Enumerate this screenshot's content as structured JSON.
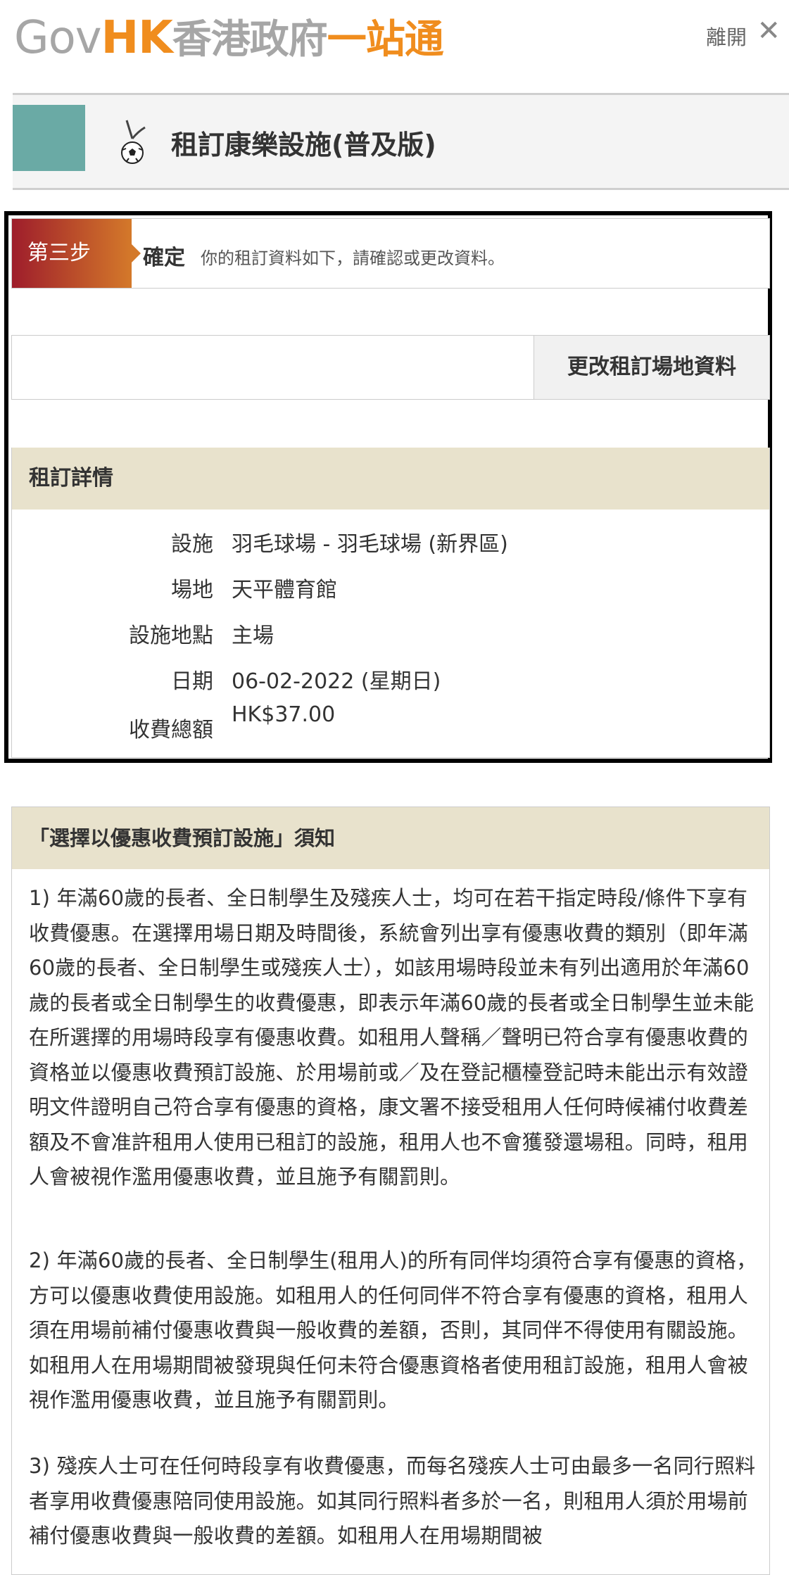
{
  "header": {
    "logo_gov": "Gov",
    "logo_hk": "HK",
    "logo_zh": "香港政府",
    "logo_zh2": "一站通",
    "leave_label": "離開",
    "close_label": "✕"
  },
  "page": {
    "title": "租訂康樂設施(普及版)"
  },
  "step": {
    "badge": "第三步",
    "name": "確定",
    "description": "你的租訂資料如下，請確認或更改資料。"
  },
  "change_button": "更改租訂場地資料",
  "details": {
    "heading": "租訂詳情",
    "rows": [
      {
        "label": "設施",
        "value": "羽毛球場 - 羽毛球場 (新界區)"
      },
      {
        "label": "場地",
        "value": "天平體育館"
      },
      {
        "label": "設施地點",
        "value": "主場"
      },
      {
        "label": "日期",
        "value": "06-02-2022 (星期日)"
      },
      {
        "label": "收費總額",
        "value": "HK$37.00"
      }
    ]
  },
  "notice": {
    "heading": "「選擇以優惠收費預訂設施」須知",
    "paragraphs": [
      "1) 年滿60歲的長者、全日制學生及殘疾人士，均可在若干指定時段/條件下享有收費優惠。在選擇用場日期及時間後，系統會列出享有優惠收費的類別（即年滿60歲的長者、全日制學生或殘疾人士），如該用場時段並未有列出適用於年滿60歲的長者或全日制學生的收費優惠，即表示年滿60歲的長者或全日制學生並未能在所選擇的用場時段享有優惠收費。如租用人聲稱／聲明已符合享有優惠收費的資格並以優惠收費預訂設施、於用場前或／及在登記櫃檯登記時未能出示有效證明文件證明自己符合享有優惠的資格，康文署不接受租用人任何時候補付收費差額及不會准許租用人使用已租訂的設施，租用人也不會獲發還場租。同時，租用人會被視作濫用優惠收費，並且施予有關罰則。",
      "2) 年滿60歲的長者、全日制學生(租用人)的所有同伴均須符合享有優惠的資格，方可以優惠收費使用設施。如租用人的任何同伴不符合享有優惠的資格，租用人須在用場前補付優惠收費與一般收費的差額，否則，其同伴不得使用有關設施。如租用人在用場期間被發現與任何未符合優惠資格者使用租訂設施，租用人會被視作濫用優惠收費，並且施予有關罰則。",
      "3) 殘疾人士可在任何時段享有收費優惠，而每名殘疾人士可由最多一名同行照料者享用收費優惠陪同使用設施。如其同行照料者多於一名，則租用人須於用場前補付優惠收費與一般收費的差額。如租用人在用場期間被"
    ]
  }
}
